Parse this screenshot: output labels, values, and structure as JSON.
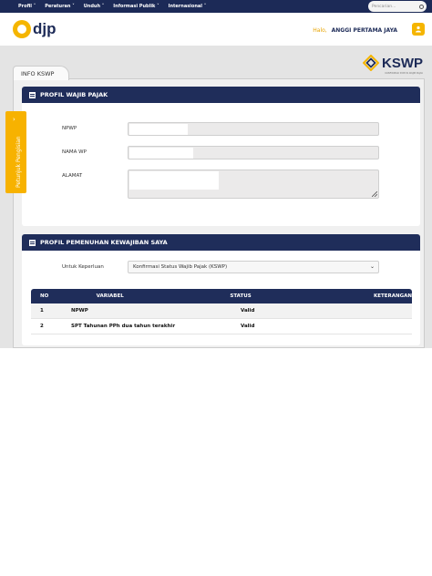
{
  "topnav": {
    "menu": [
      "Profil ˅",
      "Peraturan ˅",
      "Unduh ˅",
      "Informasi Publik ˅",
      "Internasional ˅"
    ],
    "search_placeholder": "Pencarian..."
  },
  "header": {
    "logo_text": "djp",
    "greeting": "Halo,",
    "user_name": "ANGGI PERTAMA JAYA"
  },
  "kswp_logo": {
    "text": "KSWP",
    "subtitle": "KONFIRMASI STATUS WAJIB PAJAK"
  },
  "tab": {
    "label": "INFO KSWP"
  },
  "side_tab": {
    "label": "Petunjuk Pengisian",
    "arrow": "›"
  },
  "profil": {
    "title": "PROFIL WAJIB PAJAK",
    "npwp_label": "NPWP",
    "nama_label": "NAMA WP",
    "alamat_label": "ALAMAT"
  },
  "pemenuhan": {
    "title": "PROFIL PEMENUHAN KEWAJIBAN SAYA",
    "keperluan_label": "Untuk Keperluan",
    "keperluan_value": "Konfirmasi Status Wajib Pajak (KSWP)"
  },
  "table": {
    "headers": [
      "NO",
      "VARIABEL",
      "STATUS",
      "KETERANGAN"
    ],
    "rows": [
      {
        "no": "1",
        "variabel": "NPWP",
        "status": "Valid",
        "keterangan": ""
      },
      {
        "no": "2",
        "variabel": "SPT Tahunan PPh dua tahun terakhir",
        "status": "Valid",
        "keterangan": ""
      }
    ]
  },
  "colors": {
    "navy": "#1f2d5a",
    "accent": "#f5b500"
  }
}
